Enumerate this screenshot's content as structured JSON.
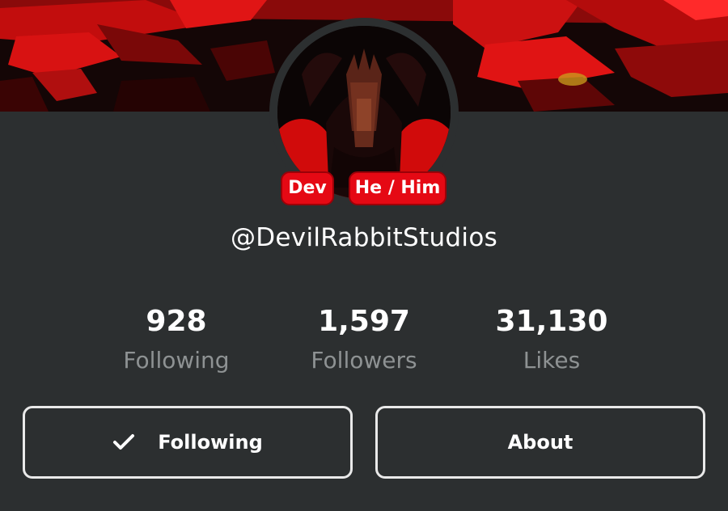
{
  "profile": {
    "badges": [
      "Dev",
      "He / Him"
    ],
    "username": "@DevilRabbitStudios"
  },
  "stats": [
    {
      "value": "928",
      "label": "Following"
    },
    {
      "value": "1,597",
      "label": "Followers"
    },
    {
      "value": "31,130",
      "label": "Likes"
    }
  ],
  "actions": {
    "follow_label": "Following",
    "follow_icon": "check-icon",
    "about_label": "About"
  },
  "colors": {
    "background": "#2c2f30",
    "accent": "#e50914",
    "muted_text": "#8e9293"
  }
}
